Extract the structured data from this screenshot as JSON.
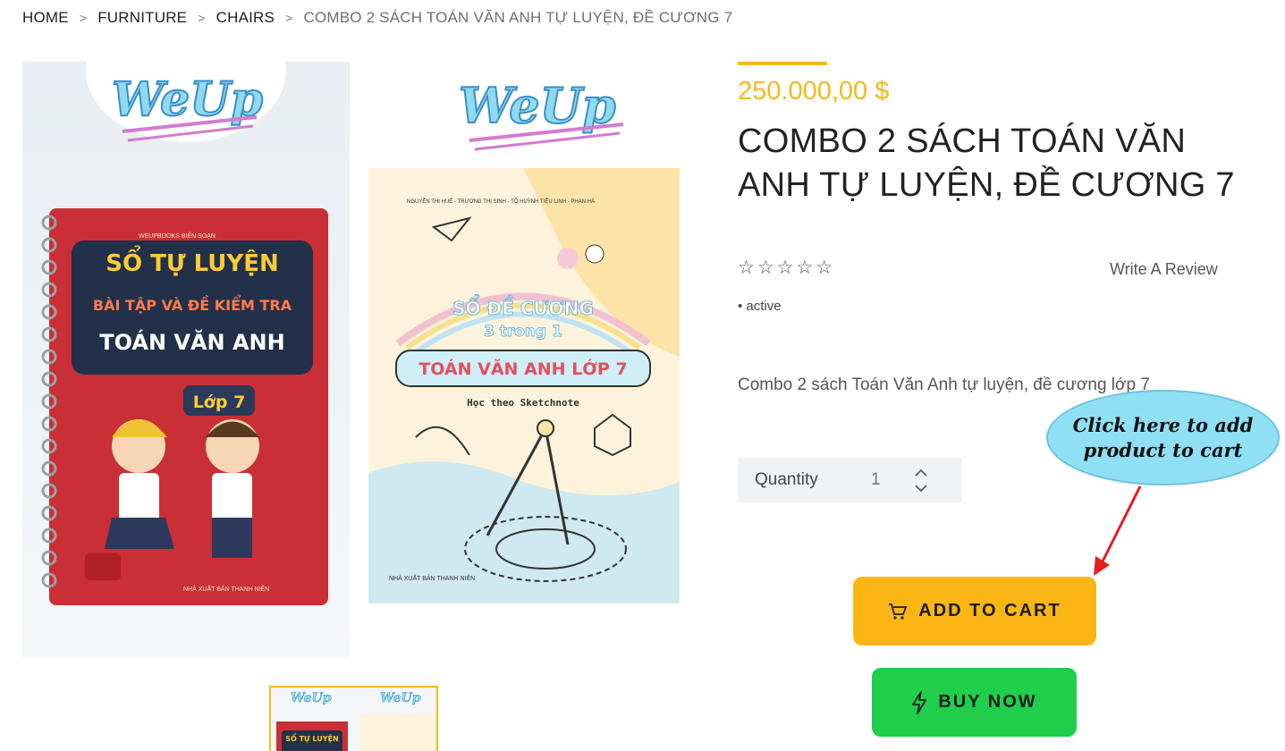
{
  "breadcrumb": {
    "items": [
      "HOME",
      "FURNITURE",
      "CHAIRS"
    ],
    "current": "COMBO 2 SÁCH TOÁN VĂN ANH TỰ LUYỆN, ĐỀ CƯƠNG 7",
    "separator": ">"
  },
  "product": {
    "price": "250.000,00 $",
    "title": "COMBO 2 SÁCH TOÁN VĂN ANH TỰ LUYỆN, ĐỀ CƯƠNG 7",
    "rating": 0,
    "rating_max": 5,
    "stars": "☆☆☆☆☆",
    "write_review": "Write A Review",
    "status": "• active",
    "description": "Combo 2 sách Toán Văn Anh tự luyện, đề cương lớp 7"
  },
  "image": {
    "brand": "WeUp",
    "book1": {
      "publisher": "WEUPBOOKS BIÊN SOẠN",
      "line1": "SỔ TỰ LUYỆN",
      "line2": "BÀI TẬP VÀ ĐỀ KIỂM TRA",
      "line3": "TOÁN VĂN ANH",
      "grade": "Lớp 7",
      "footer": "NHÀ XUẤT BẢN THANH NIÊN"
    },
    "book2": {
      "authors": "NGUYỄN THỊ HUẾ - TRƯƠNG THỊ SINH - TÔ HUỲNH TIỂU LINH - PHAN HÀ",
      "line1": "SỔ ĐỀ CƯƠNG",
      "line2": "3 trong 1",
      "line3": "TOÁN VĂN ANH LỚP 7",
      "line4": "Học theo Sketchnote",
      "footer": "NHÀ XUẤT BẢN THANH NIÊN"
    }
  },
  "quantity": {
    "label": "Quantity",
    "value": "1"
  },
  "actions": {
    "add_to_cart": "ADD TO CART",
    "buy_now": "BUY NOW"
  },
  "annotation": {
    "callout_line1": "Click here to add",
    "callout_line2": "product to cart"
  },
  "colors": {
    "accent": "#f6b81b",
    "add_to_cart_bg": "#fbb616",
    "buy_now_bg": "#1fcf4b",
    "callout_bg": "#8fe0f5",
    "arrow": "#e0201f"
  },
  "icons": {
    "add_to_cart": "cart-icon",
    "buy_now": "lightning-icon",
    "qty_up": "chevron-up-icon",
    "qty_down": "chevron-down-icon"
  }
}
